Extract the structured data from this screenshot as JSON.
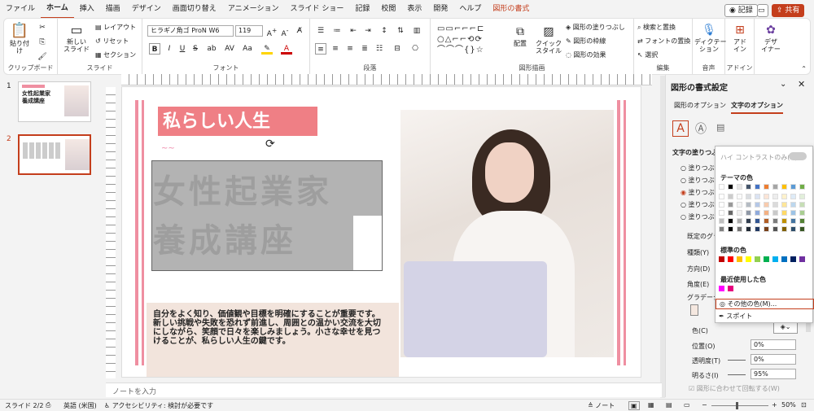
{
  "tabs": [
    "ファイル",
    "ホーム",
    "挿入",
    "描画",
    "デザイン",
    "画面切り替え",
    "アニメーション",
    "スライド ショー",
    "記録",
    "校閲",
    "表示",
    "開発",
    "ヘルプ",
    "図形の書式"
  ],
  "topright": {
    "record": "記録",
    "share": "共有"
  },
  "ribbon": {
    "clipboard": {
      "paste": "貼り付け",
      "label": "クリップボード"
    },
    "slides": {
      "new_slide": "新しい\nスライド",
      "layout": "レイアウト",
      "reset": "リセット",
      "section": "セクション",
      "label": "スライド"
    },
    "font": {
      "name": "ヒラギノ角ゴ ProN W6",
      "size": "119",
      "label": "フォント",
      "bold": "B",
      "italic": "I",
      "underline": "U",
      "strike": "S",
      "shadow": "ab",
      "spacing": "AV",
      "aa": "Aa",
      "fontcolor": "A"
    },
    "paragraph": {
      "label": "段落"
    },
    "drawing": {
      "arrange": "配置",
      "quickstyle": "クイック\nスタイル",
      "fill": "図形の塗りつぶし",
      "outline": "図形の枠線",
      "effects": "図形の効果",
      "label": "図形描画"
    },
    "editing": {
      "find": "検索と置換",
      "replace": "フォントの置換",
      "select": "選択",
      "label": "編集"
    },
    "voice": {
      "dictate": "ディクテー\nション",
      "label": "音声"
    },
    "addin": {
      "addins": "アド\nイン",
      "label": "アドイン"
    },
    "designer": {
      "designer": "デザ\nイナー"
    }
  },
  "thumbs": [
    {
      "num": "1",
      "title": "女性起業家\n養成講座"
    },
    {
      "num": "2",
      "title": ""
    }
  ],
  "slide": {
    "title_box": "私らしい人生",
    "big_text_1": "女性起業家",
    "big_text_2": "養成講座",
    "body": "自分をよく知り、価値観や目標を明確にすることが重要です。新しい挑戦や失敗を恐れず前進し、周囲との温かい交流を大切にしながら、笑顔で日々を楽しみましょう。小さな幸せを見つけることが、私らしい人生の鍵です。"
  },
  "notes": "ノートを入力",
  "pane": {
    "title": "図形の書式設定",
    "tab_shape": "図形のオプション",
    "tab_text": "文字のオプション",
    "section": "文字の塗りつぶし",
    "radios": [
      "塗りつぶしなし",
      "塗りつぶし（単色）",
      "塗りつぶし（グラデーション）",
      "塗りつぶし（図）",
      "塗りつぶし（パターン）"
    ],
    "preset": "既定のグラ",
    "type": "種類(Y)",
    "direction": "方向(D)",
    "angle": "角度(E)",
    "gradient": "グラデーショ",
    "color": "色(C)",
    "position": "位置(O)",
    "position_val": "0%",
    "transparency": "透明度(T)",
    "transparency_val": "0%",
    "brightness": "明るさ(I)",
    "brightness_val": "95%",
    "rotate": "図形に合わせて回転する(W)"
  },
  "dropdown": {
    "hc": "ハイ コントラストのみ(H)",
    "theme": "テーマの色",
    "standard": "標準の色",
    "recent": "最近使用した色",
    "more": "その他の色(M)...",
    "eyedropper": "スポイト",
    "theme_colors": [
      "#ffffff",
      "#000000",
      "#e7e6e6",
      "#44546a",
      "#4472c4",
      "#ed7d31",
      "#a5a5a5",
      "#ffc000",
      "#5b9bd5",
      "#70ad47"
    ],
    "standard_colors": [
      "#c00000",
      "#ff0000",
      "#ffc000",
      "#ffff00",
      "#92d050",
      "#00b050",
      "#00b0f0",
      "#0070c0",
      "#002060",
      "#7030a0"
    ],
    "recent_colors": [
      "#ff00ff",
      "#e6007e"
    ]
  },
  "status": {
    "slide": "スライド 2/2",
    "lang": "英語 (米国)",
    "access": "アクセシビリティ: 検討が必要です",
    "notes": "ノート",
    "zoom": "50%"
  }
}
